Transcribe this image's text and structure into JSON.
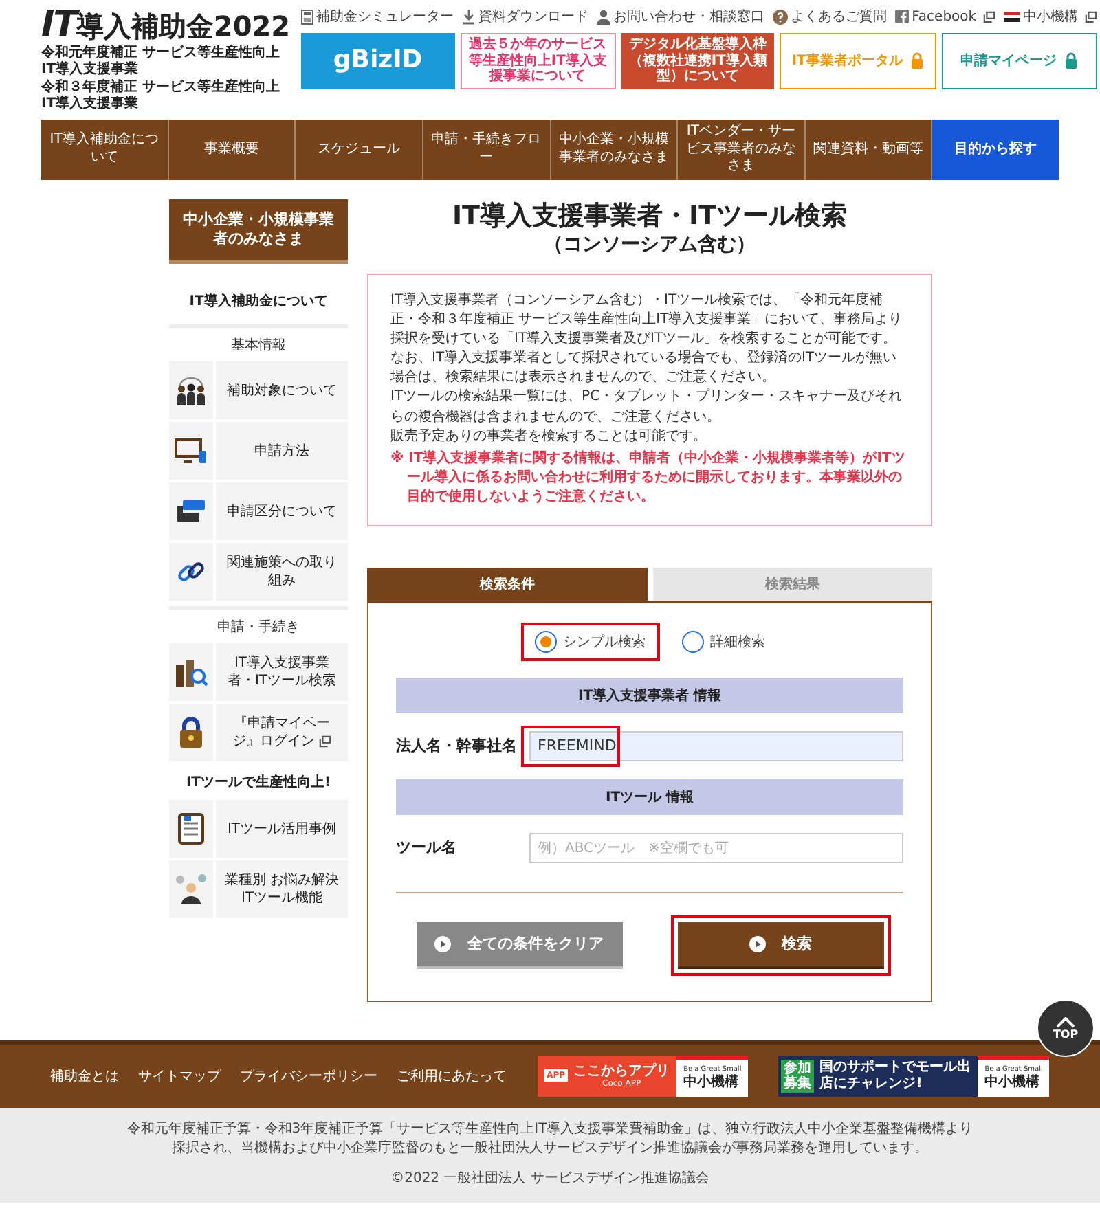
{
  "header": {
    "logo": {
      "mark": "IT",
      "title": "導入補助金2022"
    },
    "subtitles": [
      "令和元年度補正 サービス等生産性向上IT導入支援事業",
      "令和３年度補正 サービス等生産性向上IT導入支援事業"
    ],
    "top_links": [
      {
        "kind": "calculator",
        "label": "補助金シミュレーター",
        "external": false
      },
      {
        "kind": "download",
        "label": "資料ダウンロード",
        "external": false
      },
      {
        "kind": "contact",
        "label": "お問い合わせ・相談窓口",
        "external": false
      },
      {
        "kind": "faq",
        "label": "よくあるご質問",
        "external": false
      },
      {
        "kind": "facebook",
        "label": "Facebook",
        "external": true
      },
      {
        "kind": "org",
        "label": "中小機構",
        "external": true
      }
    ],
    "banners": [
      {
        "kind": "gbiz",
        "label": "gBizID",
        "locked": false
      },
      {
        "kind": "outline",
        "label": "過去５か年のサービス等生産性向上IT導入支援事業について",
        "locked": false
      },
      {
        "kind": "solid",
        "label": "デジタル化基盤導入枠（複数社連携IT導入類型）について",
        "locked": false
      },
      {
        "kind": "portal",
        "label": "IT事業者ポータル",
        "locked": true
      },
      {
        "kind": "mypage",
        "label": "申請マイページ",
        "locked": true
      }
    ]
  },
  "nav": [
    {
      "kind": "menu",
      "label": "IT導入補助金について"
    },
    {
      "kind": "menu",
      "label": "事業概要"
    },
    {
      "kind": "menu",
      "label": "スケジュール"
    },
    {
      "kind": "menu",
      "label": "申請・手続きフロー"
    },
    {
      "kind": "menu",
      "label": "中小企業・小規模事業者のみなさま"
    },
    {
      "kind": "menu",
      "label": "ITベンダー・サービス事業者のみなさま"
    },
    {
      "kind": "menu",
      "label": "関連資料・動画等"
    },
    {
      "kind": "cta",
      "label": "目的から探す"
    }
  ],
  "sidebar": {
    "title": "中小企業・小規模事業者のみなさま",
    "blocks": [
      {
        "kind": "heading",
        "label": "IT導入補助金について"
      },
      {
        "kind": "subheading",
        "label": "基本情報"
      },
      {
        "kind": "item",
        "label": "補助対象について",
        "external": false
      },
      {
        "kind": "item",
        "label": "申請方法",
        "external": false
      },
      {
        "kind": "item",
        "label": "申請区分について",
        "external": false
      },
      {
        "kind": "item",
        "label": "関連施策への取り組み",
        "external": false
      },
      {
        "kind": "subheading",
        "label": "申請・手続き"
      },
      {
        "kind": "item",
        "label": "IT導入支援事業者・ITツール検索",
        "external": false
      },
      {
        "kind": "item",
        "label": "『申請マイページ』ログイン",
        "external": true
      },
      {
        "kind": "heading",
        "label": "ITツールで生産性向上!"
      },
      {
        "kind": "item",
        "label": "ITツール活用事例",
        "external": false
      },
      {
        "kind": "item",
        "label": "業種別 お悩み解決ITツール機能",
        "external": false
      }
    ]
  },
  "page": {
    "title": "IT導入支援事業者・ITツール検索",
    "subtitle": "（コンソーシアム含む）",
    "notice": [
      "IT導入支援事業者（コンソーシアム含む）・ITツール検索では、「令和元年度補正・令和３年度補正 サービス等生産性向上IT導入支援事業」において、事務局より採択を受けている「IT導入支援事業者及びITツール」を検索することが可能です。",
      "なお、IT導入支援事業者として採択されている場合でも、登録済のITツールが無い場合は、検索結果には表示されませんので、ご注意ください。",
      "ITツールの検索結果一覧には、PC・タブレット・プリンター・スキャナー及びそれらの複合機器は含まれませんので、ご注意ください。",
      "販売予定ありの事業者を検索することは可能です。"
    ],
    "warning": "※ IT導入支援事業者に関する情報は、申請者（中小企業・小規模事業者等）がITツール導入に係るお問い合わせに利用するために開示しております。本事業以外の目的で使用しないようご注意ください。"
  },
  "search": {
    "tabs": [
      {
        "label": "検索条件",
        "selected": true
      },
      {
        "label": "検索結果",
        "selected": false
      }
    ],
    "modes": [
      {
        "label": "シンプル検索",
        "selected": true,
        "highlighted": true
      },
      {
        "label": "詳細検索",
        "selected": false,
        "highlighted": false
      }
    ],
    "sections": [
      {
        "heading": "IT導入支援事業者 情報",
        "field": {
          "label": "法人名・幹事社名",
          "value": "FREEMIND",
          "highlighted": true
        }
      },
      {
        "heading": "ITツール 情報",
        "field": {
          "label": "ツール名",
          "placeholder": "例）ABCツール　※空欄でも可",
          "highlighted": false
        }
      }
    ],
    "buttons": [
      {
        "kind": "secondary",
        "label": "全ての条件をクリア",
        "highlighted": false
      },
      {
        "kind": "primary",
        "label": "検索",
        "highlighted": true
      }
    ]
  },
  "page_top": {
    "label": "TOP"
  },
  "footer": {
    "links": [
      "補助金とは",
      "サイトマップ",
      "プライバシーポリシー",
      "ご利用にあたって"
    ],
    "banners": [
      {
        "kind": "app",
        "badge": "APP",
        "title": "ここからアプリ",
        "caption": "Coco APP",
        "tagline": "Be a Great Small",
        "org": "中小機構"
      },
      {
        "kind": "mall",
        "badge": "参加募集",
        "title": "国のサポートでモール出店にチャレンジ!",
        "tagline": "Be a Great Small",
        "org": "中小機構"
      }
    ],
    "legal": "令和元年度補正予算・令和3年度補正予算「サービス等生産性向上IT導入支援事業費補助金」は、独立行政法人中小企業基盤整備機構より採択され、当機構および中小企業庁監督のもと一般社団法人サービスデザイン推進協議会が事務局業務を運用しています。",
    "copyright": "©2022 一般社団法人 サービスデザイン推進協議会"
  }
}
